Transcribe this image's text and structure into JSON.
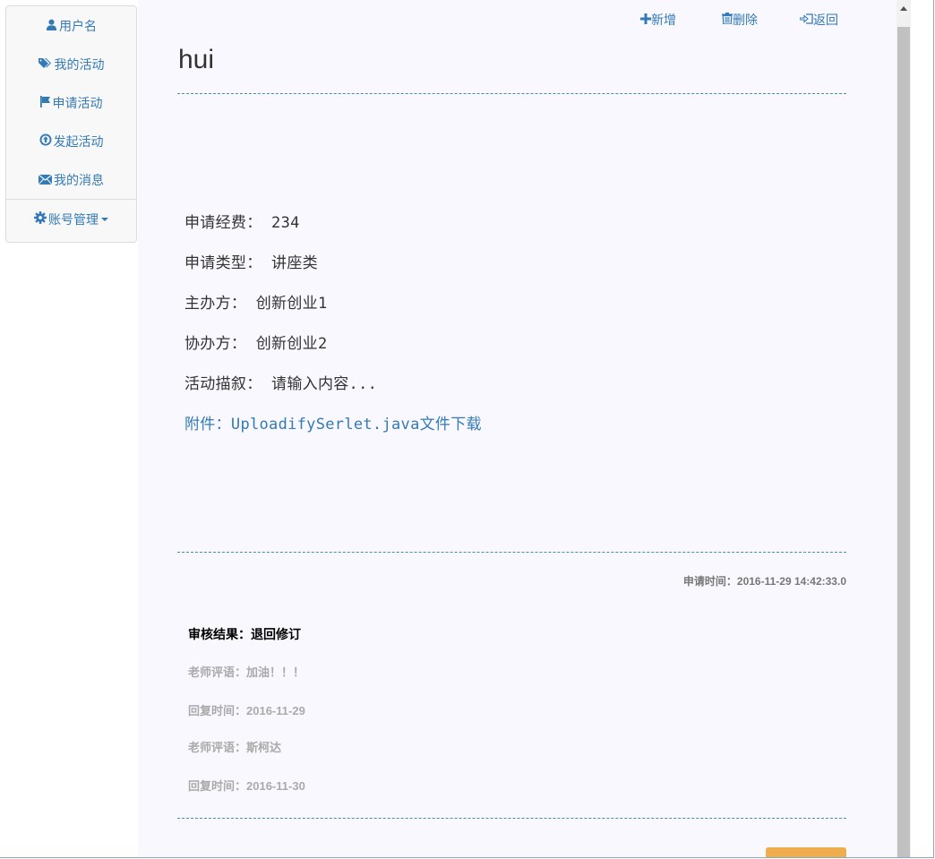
{
  "sidebar": {
    "items": [
      {
        "label": "用户名",
        "icon": "user-icon"
      },
      {
        "label": "我的活动",
        "icon": "tags-icon"
      },
      {
        "label": "申请活动",
        "icon": "flag-icon"
      },
      {
        "label": "发起活动",
        "icon": "upload-circle-icon"
      },
      {
        "label": "我的消息",
        "icon": "envelope-icon"
      }
    ],
    "account": {
      "label": "账号管理",
      "icon": "gear-icon"
    }
  },
  "toolbar": {
    "add_label": "新增",
    "delete_label": "删除",
    "back_label": "返回"
  },
  "page": {
    "title": "hui"
  },
  "details": {
    "fee_label": "申请经费：",
    "fee_value": "234",
    "type_label": "申请类型：",
    "type_value": "讲座类",
    "host_label": "主办方：",
    "host_value": "创新创业1",
    "cohost_label": "协办方：",
    "cohost_value": "创新创业2",
    "desc_label": "活动描叙：",
    "desc_value": "请输入内容...",
    "attach_label": "附件：",
    "attach_file": "UploadifySerlet.java",
    "attach_action": "文件下载"
  },
  "meta": {
    "apply_time_label": "申请时间：",
    "apply_time_value": "2016-11-29 14:42:33.0"
  },
  "review": {
    "result_label": "审核结果：",
    "result_value": "退回修订",
    "replies": [
      {
        "comment_label": "老师评语：",
        "comment": "加油！！！",
        "time_label": "回复时间：",
        "time": "2016-11-29"
      },
      {
        "comment_label": "老师评语：",
        "comment": "斯柯达",
        "time_label": "回复时间：",
        "time": "2016-11-30"
      }
    ]
  },
  "colors": {
    "link": "#337ab7",
    "panel_bg": "#f9f8fe",
    "divider": "#4a8ca8",
    "button_warning": "#f0ad4e"
  }
}
